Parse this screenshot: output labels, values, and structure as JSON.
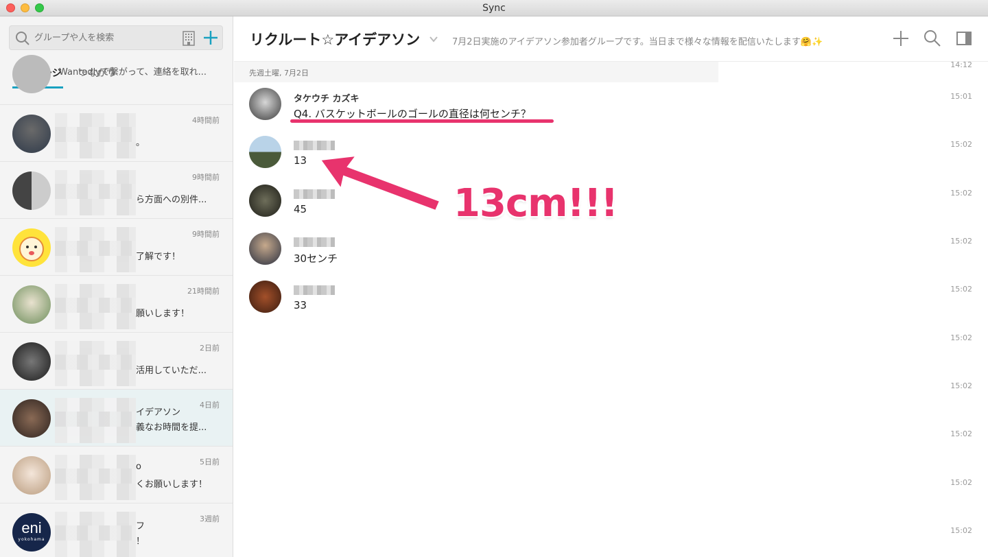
{
  "window": {
    "title": "Sync"
  },
  "sidebar": {
    "search_placeholder": "グループや人を検索",
    "tabs": [
      {
        "label": "メッセージ"
      },
      {
        "label": "つながり"
      }
    ],
    "conversations": [
      {
        "time": "",
        "preview": "Wantedlyで繋がって、連絡を取れ..."
      },
      {
        "time": "4時間前",
        "preview": "。"
      },
      {
        "time": "9時間前",
        "preview": "ら方面への別件..."
      },
      {
        "time": "9時間前",
        "preview": "了解です！"
      },
      {
        "time": "21時間前",
        "preview": "願いします！"
      },
      {
        "time": "2日前",
        "preview": "活用していただ..."
      },
      {
        "time": "4日前",
        "name_tail": "イデアソン",
        "preview": "義なお時間を提..."
      },
      {
        "time": "5日前",
        "name_tail": "o",
        "preview": "くお願いします！"
      },
      {
        "time": "3週前",
        "name_tail": "フ",
        "preview": "！",
        "avatar_text": "eni",
        "avatar_sub": "yokohama"
      }
    ]
  },
  "chat": {
    "group_name": "リクルート☆アイデアソン",
    "description": "7月2日実施のアイデアソン参加者グループです。当日まで様々な情報を配信いたします🤗✨",
    "date_separator": "先週土曜, 7月2日",
    "timestamps": [
      "14:12",
      "15:01",
      "15:02",
      "15:02",
      "15:02",
      "15:02",
      "15:02",
      "15:02",
      "15:02",
      "15:02",
      "15:02"
    ],
    "messages": [
      {
        "name": "タケウチ カズキ",
        "text": "Q4. バスケットボールのゴールの直径は何センチ？"
      },
      {
        "name": "",
        "text": "13"
      },
      {
        "name": "",
        "text": "45"
      },
      {
        "name": "",
        "text": "30センチ"
      },
      {
        "name": "",
        "text": "33"
      }
    ]
  },
  "annotation": {
    "text": "13cm!!!",
    "color": "#e8336d"
  },
  "colors": {
    "accent": "#19a1c0",
    "highlight": "#e8336d"
  }
}
